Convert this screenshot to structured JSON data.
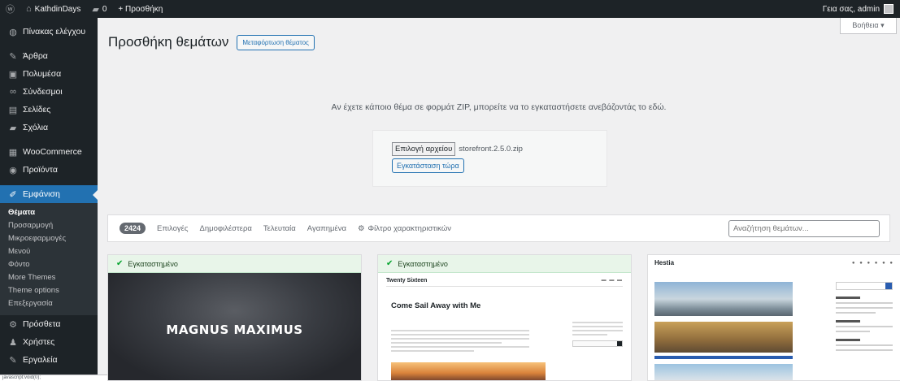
{
  "admin_bar": {
    "wp_icon": "wordpress-logo-icon",
    "site_icon": "home-icon",
    "site_name": "KathdinDays",
    "comments_icon": "comment-icon",
    "comments_count": "0",
    "new_label": "+ Προσθήκη",
    "greeting": "Γεια σας, admin"
  },
  "sidebar": {
    "items": [
      {
        "icon": "dashboard-icon",
        "glyph": "◍",
        "label": "Πίνακας ελέγχου"
      },
      {
        "icon": "pin-icon",
        "glyph": "✎",
        "label": "Άρθρα"
      },
      {
        "icon": "media-icon",
        "glyph": "▣",
        "label": "Πολυμέσα"
      },
      {
        "icon": "links-icon",
        "glyph": "∞",
        "label": "Σύνδεσμοι"
      },
      {
        "icon": "pages-icon",
        "glyph": "▤",
        "label": "Σελίδες"
      },
      {
        "icon": "comments-icon",
        "glyph": "▰",
        "label": "Σχόλια"
      },
      {
        "icon": "woocommerce-icon",
        "glyph": "▦",
        "label": "WooCommerce"
      },
      {
        "icon": "products-icon",
        "glyph": "◉",
        "label": "Προϊόντα"
      },
      {
        "icon": "appearance-icon",
        "glyph": "✐",
        "label": "Εμφάνιση"
      },
      {
        "icon": "plugins-icon",
        "glyph": "⚙",
        "label": "Πρόσθετα"
      },
      {
        "icon": "users-icon",
        "glyph": "♟",
        "label": "Χρήστες"
      },
      {
        "icon": "tools-icon",
        "glyph": "✎",
        "label": "Εργαλεία"
      }
    ],
    "submenu": [
      "Θέματα",
      "Προσαρμογή",
      "Μικροεφαρμογές",
      "Μενού",
      "Φόντο",
      "More Themes",
      "Theme options",
      "Επεξεργασία"
    ]
  },
  "status_bar": "javascript:void(0);",
  "main": {
    "title": "Προσθήκη θεμάτων",
    "title_button": "Μεταφόρτωση θέματος",
    "help_label": "Βοήθεια ▾",
    "upload_text": "Αν έχετε κάποιο θέμα σε φορμάτ ZIP, μπορείτε να το εγκαταστήσετε ανεβάζοντάς το εδώ.",
    "choose_file": "Επιλογή αρχείου",
    "file_name": "storefront.2.5.0.zip",
    "install_now": "Εγκατάσταση τώρα"
  },
  "filter": {
    "count": "2424",
    "links": [
      "Επιλογές",
      "Δημοφιλέστερα",
      "Τελευταία",
      "Αγαπημένα"
    ],
    "feature_filter": "Φίλτρο χαρακτηριστικών",
    "search_placeholder": "Αναζήτηση θεμάτων..."
  },
  "themes": [
    {
      "installed": "Εγκαταστημένο",
      "name": "MAGNUS MAXIMUS"
    },
    {
      "installed": "Εγκαταστημένο",
      "brand": "Twenty Sixteen",
      "post_title": "Come Sail Away with Me"
    },
    {
      "brand": "Hestia"
    }
  ]
}
